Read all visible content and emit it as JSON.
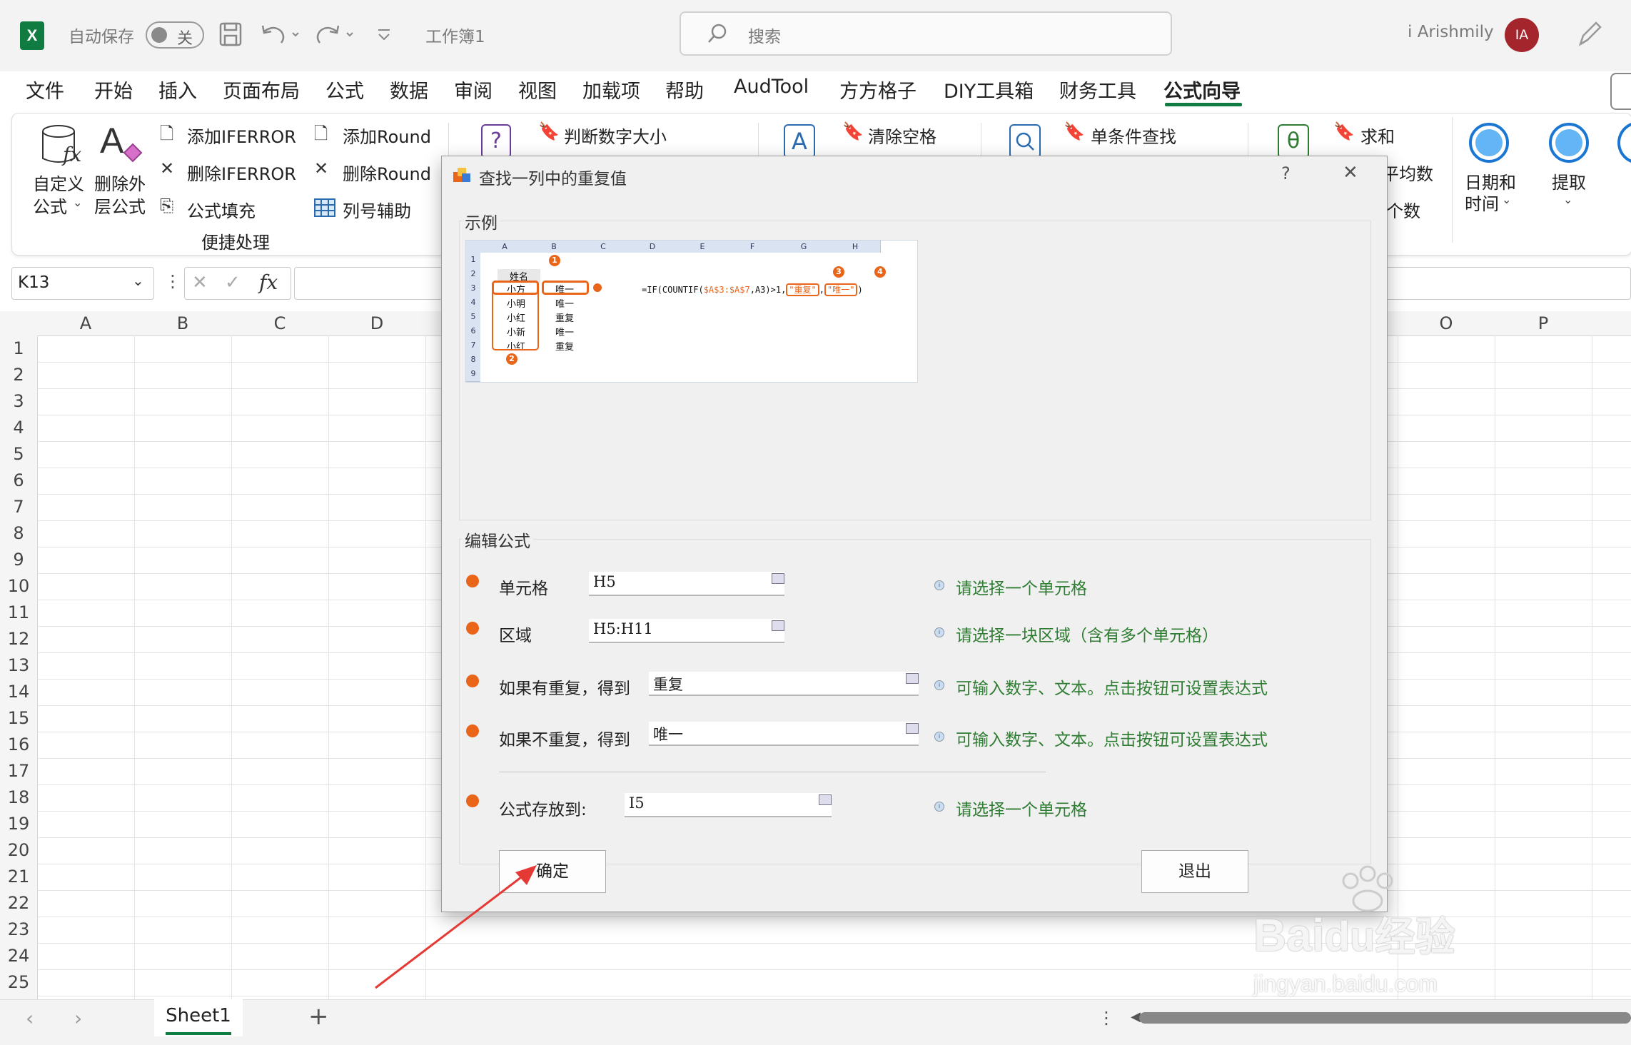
{
  "app": {
    "autosave_label": "自动保存",
    "autosave_state": "关",
    "doc_title": "工作簿1",
    "search_placeholder": "搜索",
    "user_name": "i Arishmily",
    "user_initials": "IA",
    "brand_color": "#107c41"
  },
  "tabs": [
    "文件",
    "开始",
    "插入",
    "页面布局",
    "公式",
    "数据",
    "审阅",
    "视图",
    "加载项",
    "帮助",
    "AudTool",
    "方方格子",
    "DIY工具箱",
    "财务工具",
    "公式向导"
  ],
  "active_tab": "公式向导",
  "ribbon": {
    "custom_formula": "自定义公式",
    "custom_formula_l1": "自定义",
    "custom_formula_l2": "公式",
    "remove_outer_l1": "删除外",
    "remove_outer_l2": "层公式",
    "add_iferror": "添加IFERROR",
    "del_iferror": "删除IFERROR",
    "formula_fill": "公式填充",
    "add_round": "添加Round",
    "del_round": "删除Round",
    "col_helper": "列号辅助",
    "group_label": "便捷处理",
    "judge_num": "判断数字大小",
    "clear_space": "清除空格",
    "single_lookup": "单条件查找",
    "sum": "求和",
    "average_partial": "平均数",
    "count_partial": "个数",
    "date_time_l1": "日期和",
    "date_time_l2": "时间",
    "extract": "提取"
  },
  "formula_bar": {
    "name_box": "K13",
    "fx": "fx",
    "value": ""
  },
  "grid": {
    "columns": [
      "A",
      "B",
      "C",
      "D",
      "O",
      "P"
    ],
    "rows": [
      "1",
      "2",
      "3",
      "4",
      "5",
      "6",
      "7",
      "8",
      "9",
      "10",
      "11",
      "12",
      "13",
      "14",
      "15",
      "16",
      "17",
      "18",
      "19",
      "20",
      "21",
      "22",
      "23",
      "24",
      "25"
    ]
  },
  "sheet": {
    "tab_name": "Sheet1",
    "add_sheet": "+"
  },
  "dialog": {
    "title": "查找一列中的重复值",
    "help": "?",
    "close": "✕",
    "example_group": "示例",
    "edit_group": "编辑公式",
    "sample": {
      "columns": [
        "A",
        "B",
        "C",
        "D",
        "E",
        "F",
        "G",
        "H"
      ],
      "rows": [
        "1",
        "2",
        "3",
        "4",
        "5",
        "6",
        "7",
        "8",
        "9"
      ],
      "header": "姓名",
      "names": [
        "小方",
        "小明",
        "小红",
        "小新",
        "小红"
      ],
      "results": [
        "唯一",
        "唯一",
        "重复",
        "唯一",
        "重复"
      ],
      "formula_prefix": "=IF(COUNTIF(",
      "formula_range": "$A$3:$A$7",
      "formula_mid": ",A3)>1,",
      "formula_dup": "\"重复\"",
      "formula_sep": ",",
      "formula_uniq": "\"唯一\"",
      "formula_end": ")",
      "badges": [
        "1",
        "2",
        "3",
        "4"
      ]
    },
    "fields": {
      "cell_label": "单元格",
      "cell_value": "H5",
      "cell_hint": "请选择一个单元格",
      "range_label": "区域",
      "range_value": "H5:H11",
      "range_hint": "请选择一块区域（含有多个单元格）",
      "dup_label": "如果有重复，得到",
      "dup_value": "重复",
      "dup_hint": "可输入数字、文本。点击按钮可设置表达式",
      "uniq_label": "如果不重复，得到",
      "uniq_value": "唯一",
      "uniq_hint": "可输入数字、文本。点击按钮可设置表达式",
      "target_label": "公式存放到:",
      "target_value": "I5",
      "target_hint": "请选择一个单元格"
    },
    "ok": "确定",
    "exit": "退出"
  },
  "watermark": {
    "brand": "Bai",
    "brand2": "du",
    "jingyan": "经验",
    "url": "jingyan.baidu.com"
  }
}
